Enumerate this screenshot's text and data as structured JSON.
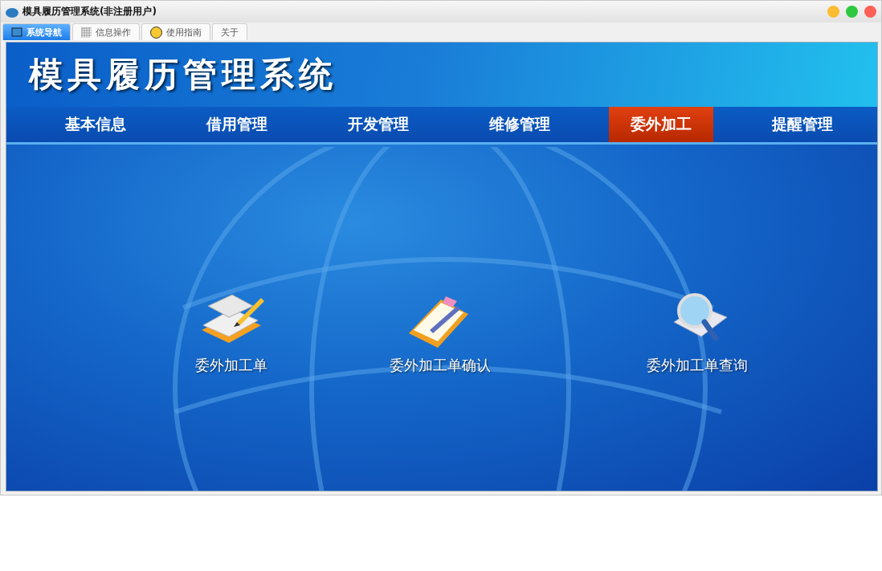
{
  "window": {
    "title": "模具履历管理系统(非注册用户)"
  },
  "tabs": [
    {
      "label": "系统导航",
      "kind": "monitor",
      "selected": true
    },
    {
      "label": "信息操作",
      "kind": "grid",
      "selected": false
    },
    {
      "label": "使用指南",
      "kind": "help",
      "selected": false
    },
    {
      "label": "关于",
      "selected": false
    }
  ],
  "banner": {
    "title": "模具履历管理系统"
  },
  "nav": [
    {
      "label": "基本信息",
      "selected": false
    },
    {
      "label": "借用管理",
      "selected": false
    },
    {
      "label": "开发管理",
      "selected": false
    },
    {
      "label": "维修管理",
      "selected": false
    },
    {
      "label": "委外加工",
      "selected": true
    },
    {
      "label": "提醒管理",
      "selected": false
    }
  ],
  "functions": [
    {
      "label": "委外加工单",
      "kind": "notebook"
    },
    {
      "label": "委外加工单确认",
      "kind": "clipboard"
    },
    {
      "label": "委外加工单查询",
      "kind": "magnifier"
    }
  ]
}
